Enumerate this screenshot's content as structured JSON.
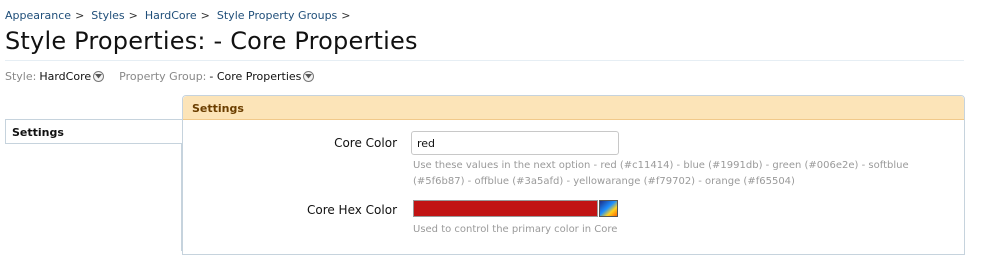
{
  "breadcrumb": [
    {
      "label": "Appearance",
      "sep": ">"
    },
    {
      "label": "Styles",
      "sep": ">"
    },
    {
      "label": "HardCore",
      "sep": ">"
    },
    {
      "label": "Style Property Groups",
      "sep": ">"
    }
  ],
  "page": {
    "title": "Style Properties: - Core Properties"
  },
  "filters": {
    "style_label": "Style:",
    "style_value": "HardCore",
    "group_label": "Property Group:",
    "group_value": "- Core Properties"
  },
  "sidebar": {
    "tab_label": "Settings"
  },
  "settings": {
    "header": "Settings",
    "core_color": {
      "label": "Core Color",
      "value": "red",
      "hint_line1": "Use these values in the next option - red (#c11414) - blue (#1991db) - green (#006e2e) - softblue",
      "hint_line2": "(#5f6b87) - offblue (#3a5afd) - yellowarange (#f79702) - orange (#f65504)"
    },
    "core_hex_color": {
      "label": "Core Hex Color",
      "color": "#c11414",
      "hint": "Used to control the primary color in Core"
    }
  },
  "colors": {
    "link": "#1f4e79",
    "header_bg": "#fce4b8",
    "border": "#c6d3dd"
  }
}
